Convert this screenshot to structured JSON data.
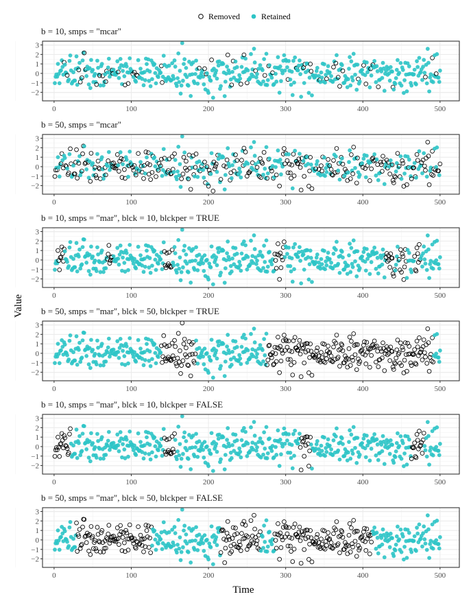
{
  "chart_data": {
    "type": "scatter",
    "xlabel": "Time",
    "ylabel": "Value",
    "xlim": [
      -15,
      525
    ],
    "ylim": [
      -2.9,
      3.4
    ],
    "x_ticks": [
      0,
      100,
      200,
      300,
      400,
      500
    ],
    "y_ticks": [
      -2,
      -1,
      0,
      1,
      2,
      3
    ],
    "grid": true,
    "legend": {
      "position": "top",
      "entries": [
        {
          "label": "Removed",
          "marker": "open-circle",
          "color": "#000000"
        },
        {
          "label": "Retained",
          "marker": "filled-circle",
          "color": "#2EC4C6"
        }
      ]
    },
    "series_length": 500,
    "series_seed": 20240607,
    "series_note": "Same underlying noisy time series (values roughly in [-2.7, 3.3]) in all panels; panels differ only by which observations are marked Removed.",
    "panels": [
      {
        "title": "b = 10, smps = \"mcar\"",
        "scheme": "mcar",
        "removed_fraction": 0.1,
        "removed_ranges": []
      },
      {
        "title": "b = 50, smps = \"mcar\"",
        "scheme": "mcar",
        "removed_fraction": 0.5,
        "removed_ranges": []
      },
      {
        "title": "b = 10, smps = \"mar\", blck = 10, blckper = TRUE",
        "scheme": "mar",
        "removed_ranges": [
          [
            4,
            12
          ],
          [
            68,
            75
          ],
          [
            142,
            152
          ],
          [
            285,
            297
          ],
          [
            429,
            440
          ],
          [
            446,
            455
          ],
          [
            466,
            473
          ]
        ]
      },
      {
        "title": "b = 50, smps = \"mar\", blck = 50, blckper = TRUE",
        "scheme": "mar",
        "removed_ranges": [
          [
            138,
            182
          ],
          [
            275,
            490
          ]
        ]
      },
      {
        "title": "b = 10, smps = \"mar\", blck = 10, blckper = FALSE",
        "scheme": "mar",
        "removed_ranges": [
          [
            0,
            20
          ],
          [
            142,
            155
          ],
          [
            318,
            331
          ],
          [
            462,
            478
          ]
        ]
      },
      {
        "title": "b = 50, smps = \"mar\", blck = 50, blckper = FALSE",
        "scheme": "mar",
        "removed_ranges": [
          [
            28,
            125
          ],
          [
            215,
            266
          ],
          [
            285,
            411
          ]
        ]
      }
    ]
  }
}
